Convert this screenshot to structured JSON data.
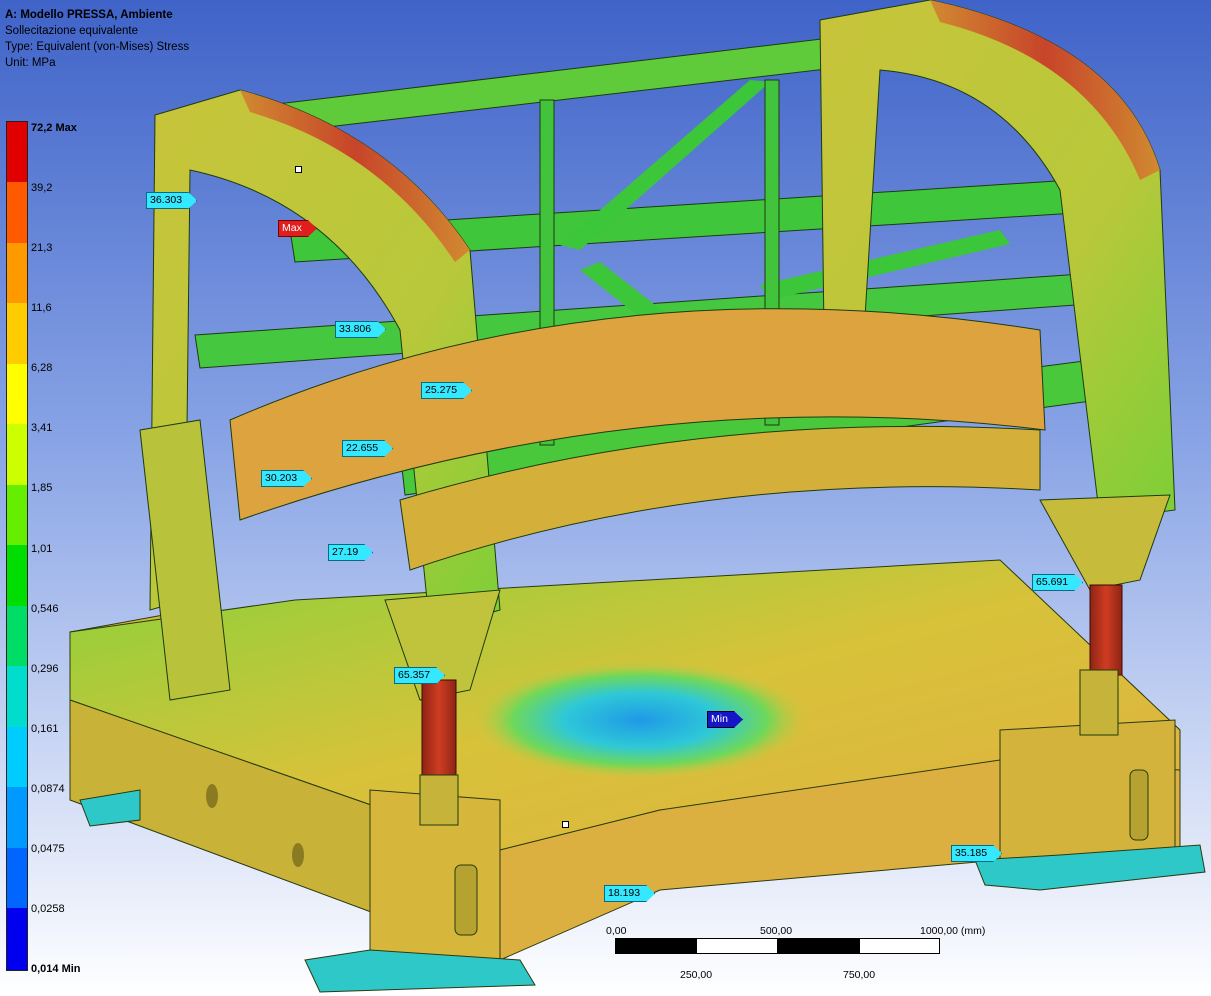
{
  "header": {
    "title": "A: Modello PRESSA, Ambiente",
    "result_name": "Sollecitazione equivalente",
    "type": "Type: Equivalent (von-Mises) Stress",
    "unit": "Unit: MPa"
  },
  "legend": {
    "labels": [
      "72,2 Max",
      "39,2",
      "21,3",
      "11,6",
      "6,28",
      "3,41",
      "1,85",
      "1,01",
      "0,546",
      "0,296",
      "0,161",
      "0,0874",
      "0,0475",
      "0,0258",
      "0,014 Min"
    ],
    "colors": [
      "#e00000",
      "#ff5a00",
      "#ff9900",
      "#ffcc00",
      "#ffff00",
      "#ccff00",
      "#66ee00",
      "#00dd00",
      "#00dd66",
      "#00ddcc",
      "#00ccff",
      "#0099ff",
      "#0066ff",
      "#0033ff",
      "#0000ee"
    ]
  },
  "probes": [
    {
      "id": "p1",
      "text": "36.303",
      "kind": "value"
    },
    {
      "id": "p2",
      "text": "Max",
      "kind": "max"
    },
    {
      "id": "p3",
      "text": "33.806",
      "kind": "value"
    },
    {
      "id": "p4",
      "text": "25.275",
      "kind": "value"
    },
    {
      "id": "p5",
      "text": "22.655",
      "kind": "value"
    },
    {
      "id": "p6",
      "text": "30.203",
      "kind": "value"
    },
    {
      "id": "p7",
      "text": "27.19",
      "kind": "value"
    },
    {
      "id": "p8",
      "text": "65.691",
      "kind": "value"
    },
    {
      "id": "p9",
      "text": "65.357",
      "kind": "value"
    },
    {
      "id": "p10",
      "text": "Min",
      "kind": "min"
    },
    {
      "id": "p11",
      "text": "35.185",
      "kind": "value"
    },
    {
      "id": "p12",
      "text": "18.193",
      "kind": "value"
    }
  ],
  "scale_bar": {
    "top_labels": [
      "0,00",
      "500,00",
      "1000,00 (mm)"
    ],
    "bottom_labels": [
      "250,00",
      "750,00"
    ]
  },
  "colors": {
    "background_top": "#3f63c8",
    "background_bottom": "#ffffff",
    "model_green": "#4fc83a",
    "model_yellow": "#d8c23a",
    "model_orange": "#e3a63a",
    "model_red": "#c93a1e"
  }
}
